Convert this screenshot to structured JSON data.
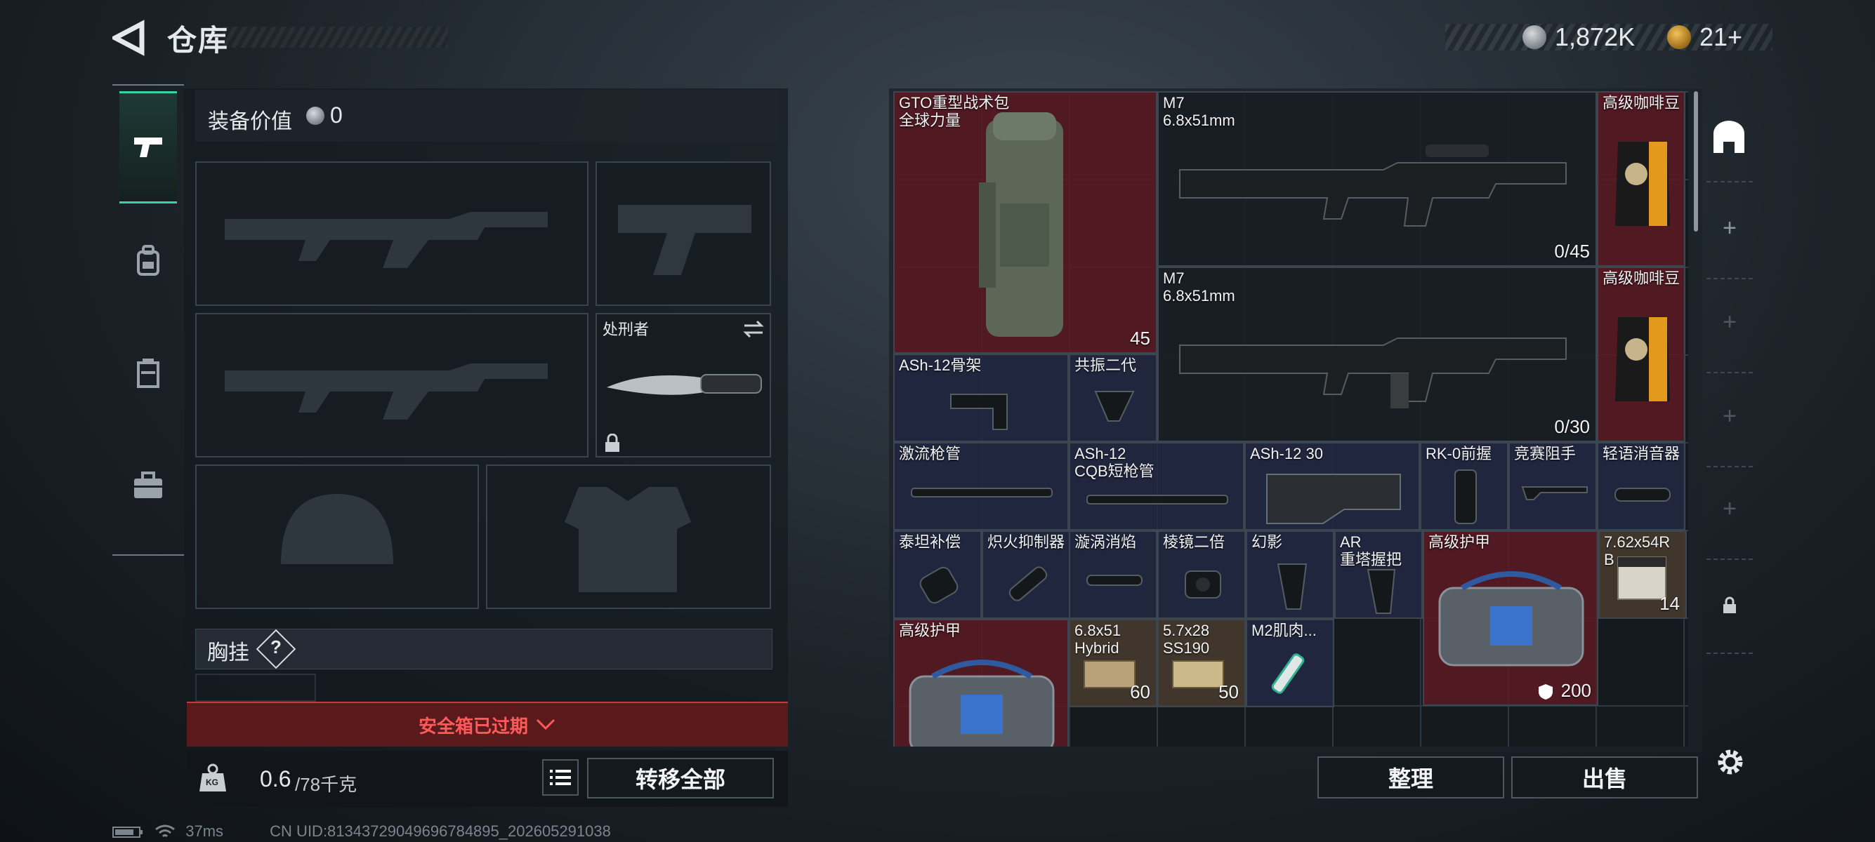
{
  "header": {
    "title": "仓库",
    "currency1": "1,872K",
    "currency2": "21+"
  },
  "loadout": {
    "value_label": "装备价值",
    "value": "0",
    "melee_name": "处刑者",
    "chest_label": "胸挂",
    "help": "?",
    "expired_text": "安全箱已过期",
    "weight": "0.6",
    "weight_max": "/78千克",
    "weight_icon": "KG",
    "transfer_all": "转移全部"
  },
  "stash": {
    "items": [
      {
        "label": "GTO重型战术包\n全球力量",
        "count": "45"
      },
      {
        "label": "M7\n6.8x51mm",
        "count": "0/45"
      },
      {
        "label": "高级咖啡豆"
      },
      {
        "label": "M7\n6.8x51mm",
        "count": "0/30"
      },
      {
        "label": "高级咖啡豆"
      },
      {
        "label": "ASh-12骨架"
      },
      {
        "label": "共振二代"
      },
      {
        "label": "激流枪管"
      },
      {
        "label": "ASh-12\nCQB短枪管"
      },
      {
        "label": "ASh-12 30"
      },
      {
        "label": "RK-0前握"
      },
      {
        "label": "竞赛阻手"
      },
      {
        "label": "轻语消音器"
      },
      {
        "label": "泰坦补偿"
      },
      {
        "label": "炽火抑制器"
      },
      {
        "label": "漩涡消焰"
      },
      {
        "label": "棱镜二倍"
      },
      {
        "label": "幻影"
      },
      {
        "label": "AR\n重塔握把"
      },
      {
        "label": "高级护甲",
        "count": "200"
      },
      {
        "label": "7.62x54R\nB",
        "count": "14"
      },
      {
        "label": "高级护甲"
      },
      {
        "label": "6.8x51\nHybrid",
        "count": "60"
      },
      {
        "label": "5.7x28\nSS190",
        "count": "50"
      },
      {
        "label": "M2肌肉..."
      }
    ],
    "sort_button": "整理",
    "sell_button": "出售"
  },
  "footer": {
    "ping": "37ms",
    "uid": "CN UID:81343729049696784895_202605291038"
  },
  "colors": {
    "accent": "#39d2a8",
    "expired": "#ff5a5a",
    "red_item": "#5c1a22",
    "blue_item": "#222842"
  },
  "icons": [
    "back-arrow-icon",
    "silver-coin-icon",
    "gold-coin-icon",
    "pistol-icon",
    "backpack-icon",
    "vest-icon",
    "toolbox-icon",
    "swap-icon",
    "lock-icon",
    "chevron-down-icon",
    "list-icon",
    "helmet-icon",
    "shield-icon",
    "gear-icon",
    "battery-icon",
    "wifi-icon"
  ]
}
